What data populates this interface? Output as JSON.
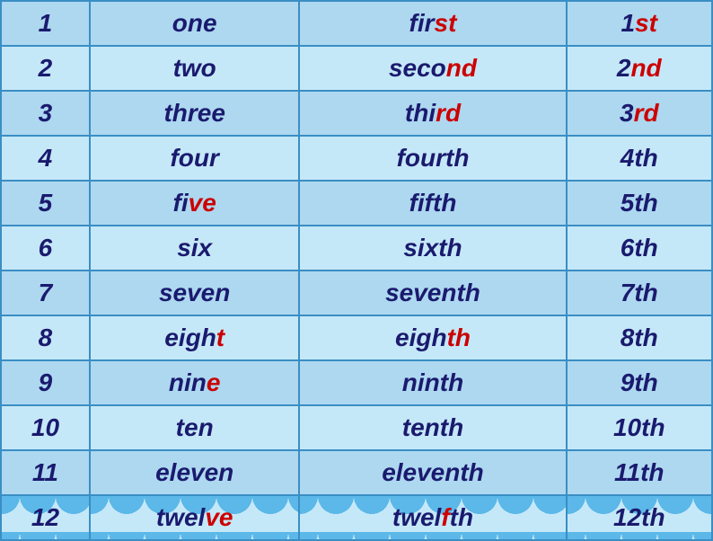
{
  "table": {
    "rows": [
      {
        "num": "1",
        "word": "one",
        "ordinal_parts": [
          {
            "text": "fir",
            "red": false
          },
          {
            "text": "st",
            "red": true
          }
        ],
        "abbr_parts": [
          {
            "text": "1",
            "red": false
          },
          {
            "text": "st",
            "red": true
          }
        ]
      },
      {
        "num": "2",
        "word": "two",
        "ordinal_parts": [
          {
            "text": "seco",
            "red": false
          },
          {
            "text": "nd",
            "red": true
          }
        ],
        "abbr_parts": [
          {
            "text": "2",
            "red": false
          },
          {
            "text": "nd",
            "red": true
          }
        ]
      },
      {
        "num": "3",
        "word": "three",
        "ordinal_parts": [
          {
            "text": "thi",
            "red": false
          },
          {
            "text": "rd",
            "red": true
          }
        ],
        "abbr_parts": [
          {
            "text": "3",
            "red": false
          },
          {
            "text": "rd",
            "red": true
          }
        ]
      },
      {
        "num": "4",
        "word": "four",
        "ordinal_parts": [
          {
            "text": "fourth",
            "red": false
          }
        ],
        "abbr_parts": [
          {
            "text": "4th",
            "red": false
          }
        ]
      },
      {
        "num": "5",
        "word_parts": [
          {
            "text": "fi",
            "red": false
          },
          {
            "text": "ve",
            "red": true
          }
        ],
        "ordinal_parts": [
          {
            "text": "fi",
            "red": false
          },
          {
            "text": "f",
            "red": false
          },
          {
            "text": "th",
            "red": false
          }
        ],
        "abbr_parts": [
          {
            "text": "5th",
            "red": false
          }
        ]
      },
      {
        "num": "6",
        "word": "six",
        "ordinal_parts": [
          {
            "text": "sixth",
            "red": false
          }
        ],
        "abbr_parts": [
          {
            "text": "6th",
            "red": false
          }
        ]
      },
      {
        "num": "7",
        "word": "seven",
        "ordinal_parts": [
          {
            "text": "seventh",
            "red": false
          }
        ],
        "abbr_parts": [
          {
            "text": "7th",
            "red": false
          }
        ]
      },
      {
        "num": "8",
        "word_parts": [
          {
            "text": "eigh",
            "red": false
          },
          {
            "text": "t",
            "red": true
          }
        ],
        "ordinal_parts": [
          {
            "text": "eigh",
            "red": false
          },
          {
            "text": "th",
            "red": true
          }
        ],
        "abbr_parts": [
          {
            "text": "8th",
            "red": false
          }
        ]
      },
      {
        "num": "9",
        "word_parts": [
          {
            "text": "nin",
            "red": false
          },
          {
            "text": "e",
            "red": true
          }
        ],
        "ordinal_parts": [
          {
            "text": "ninth",
            "red": false
          }
        ],
        "abbr_parts": [
          {
            "text": "9th",
            "red": false
          }
        ]
      },
      {
        "num": "10",
        "word": "ten",
        "ordinal_parts": [
          {
            "text": "tenth",
            "red": false
          }
        ],
        "abbr_parts": [
          {
            "text": "10th",
            "red": false
          }
        ]
      },
      {
        "num": "11",
        "word": "eleven",
        "ordinal_parts": [
          {
            "text": "eleventh",
            "red": false
          }
        ],
        "abbr_parts": [
          {
            "text": "11th",
            "red": false
          }
        ]
      },
      {
        "num": "12",
        "word_parts": [
          {
            "text": "twel",
            "red": false
          },
          {
            "text": "ve",
            "red": true
          }
        ],
        "ordinal_parts": [
          {
            "text": "twel",
            "red": false
          },
          {
            "text": "f",
            "red": true
          },
          {
            "text": "th",
            "red": false
          }
        ],
        "abbr_parts": [
          {
            "text": "12th",
            "red": false
          }
        ]
      }
    ]
  }
}
